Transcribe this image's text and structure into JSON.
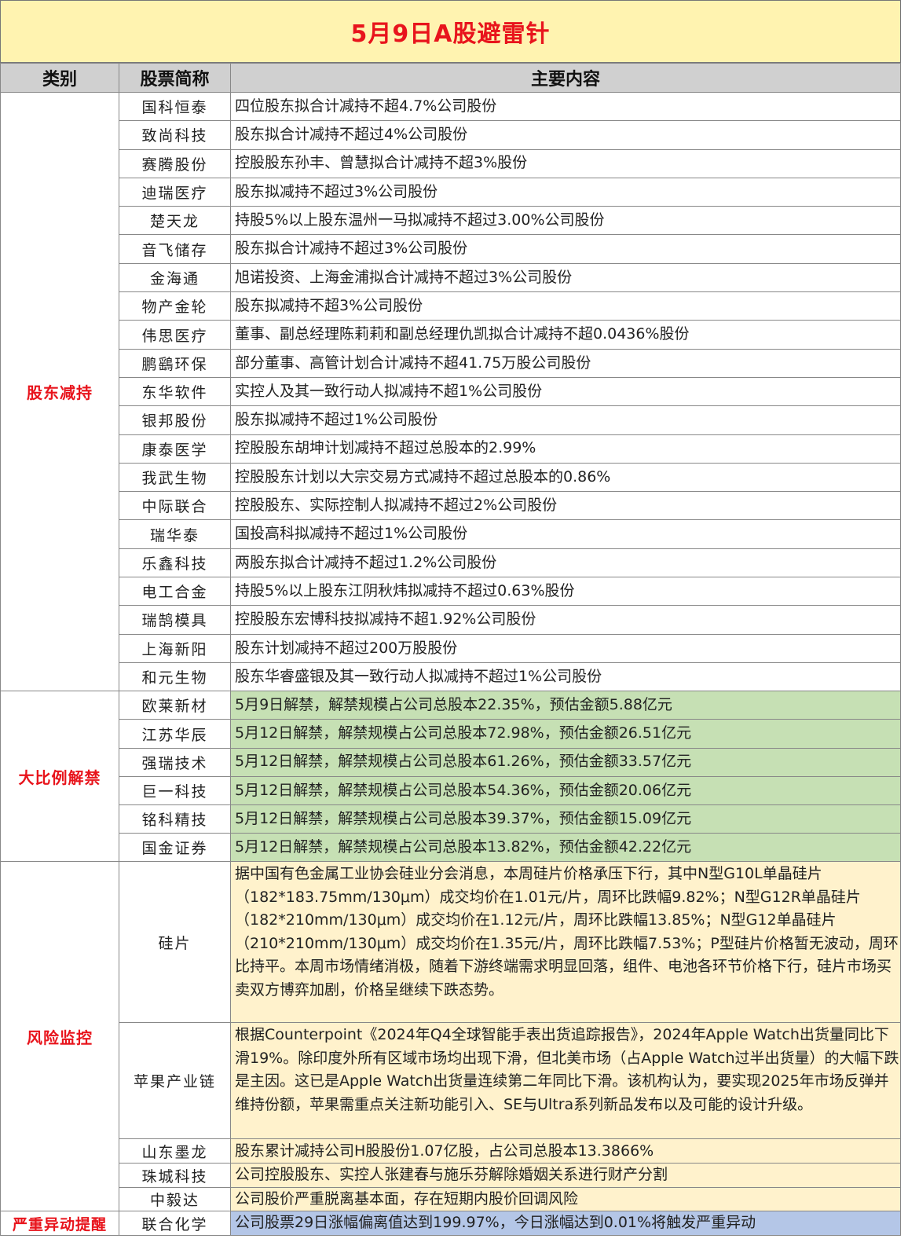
{
  "title": "5月9日A股避雷针",
  "headers": {
    "category": "类别",
    "stock": "股票简称",
    "content": "主要内容"
  },
  "sections": [
    {
      "category": "股东减持",
      "style": "plain",
      "rows": [
        {
          "name": "国科恒泰",
          "content": "四位股东拟合计减持不超4.7%公司股份"
        },
        {
          "name": "致尚科技",
          "content": "股东拟合计减持不超过4%公司股份"
        },
        {
          "name": "赛腾股份",
          "content": "控股股东孙丰、曾慧拟合计减持不超3%股份"
        },
        {
          "name": "迪瑞医疗",
          "content": "股东拟减持不超过3%公司股份"
        },
        {
          "name": "楚天龙",
          "content": "持股5%以上股东温州一马拟减持不超过3.00%公司股份"
        },
        {
          "name": "音飞储存",
          "content": "股东拟合计减持不超过3%公司股份"
        },
        {
          "name": "金海通",
          "content": "旭诺投资、上海金浦拟合计减持不超过3%公司股份"
        },
        {
          "name": "物产金轮",
          "content": "股东拟减持不超3%公司股份"
        },
        {
          "name": "伟思医疗",
          "content": "董事、副总经理陈莉莉和副总经理仇凯拟合计减持不超0.0436%股份"
        },
        {
          "name": "鹏鷂环保",
          "content": "部分董事、高管计划合计减持不超41.75万股公司股份"
        },
        {
          "name": "东华软件",
          "content": "实控人及其一致行动人拟减持不超1%公司股份"
        },
        {
          "name": "银邦股份",
          "content": "股东拟减持不超过1%公司股份"
        },
        {
          "name": "康泰医学",
          "content": "控股股东胡坤计划减持不超过总股本的2.99%"
        },
        {
          "name": "我武生物",
          "content": "控股股东计划以大宗交易方式减持不超过总股本的0.86%"
        },
        {
          "name": "中际联合",
          "content": "控股股东、实际控制人拟减持不超过2%公司股份"
        },
        {
          "name": "瑞华泰",
          "content": "国投高科拟减持不超过1%公司股份"
        },
        {
          "name": "乐鑫科技",
          "content": "两股东拟合计减持不超过1.2%公司股份"
        },
        {
          "name": "电工合金",
          "content": "持股5%以上股东江阴秋炜拟减持不超过0.63%股份"
        },
        {
          "name": "瑞鹄模具",
          "content": "控股股东宏博科技拟减持不超1.92%公司股份"
        },
        {
          "name": "上海新阳",
          "content": "股东计划减持不超过200万股股份"
        },
        {
          "name": "和元生物",
          "content": "股东华睿盛银及其一致行动人拟减持不超过1%公司股份"
        }
      ]
    },
    {
      "category": "大比例解禁",
      "style": "green",
      "rows": [
        {
          "name": "欧莱新材",
          "content": "5月9日解禁，解禁规模占公司总股本22.35%，预估金额5.88亿元"
        },
        {
          "name": "江苏华辰",
          "content": "5月12日解禁，解禁规模占公司总股本72.98%，预估金额26.51亿元"
        },
        {
          "name": "强瑞技术",
          "content": "5月12日解禁，解禁规模占公司总股本61.26%，预估金额33.57亿元"
        },
        {
          "name": "巨一科技",
          "content": "5月12日解禁，解禁规模占公司总股本54.36%，预估金额20.06亿元"
        },
        {
          "name": "铭科精技",
          "content": "5月12日解禁，解禁规模占公司总股本39.37%，预估金额15.09亿元"
        },
        {
          "name": "国金证券",
          "content": "5月12日解禁，解禁规模占公司总股本13.82%，预估金额42.22亿元"
        }
      ]
    },
    {
      "category": "风险监控",
      "style": "yellow",
      "rows": [
        {
          "name": "硅片",
          "content": "据中国有色金属工业协会硅业分会消息，本周硅片价格承压下行，其中N型G10L单晶硅片（182*183.75mm/130μm）成交均价在1.01元/片，周环比跌幅9.82%；N型G12R单晶硅片（182*210mm/130μm）成交均价在1.12元/片，周环比跌幅13.85%；N型G12单晶硅片（210*210mm/130μm）成交均价在1.35元/片，周环比跌幅7.53%；P型硅片价格暂无波动，周环比持平。本周市场情绪消极，随着下游终端需求明显回落，组件、电池各环节价格下行，硅片市场买卖双方博弈加剧，价格呈继续下跌态势。"
        },
        {
          "name": "苹果产业链",
          "content": "根据Counterpoint《2024年Q4全球智能手表出货追踪报告》，2024年Apple Watch出货量同比下滑19%。除印度外所有区域市场均出现下滑，但北美市场（占Apple Watch过半出货量）的大幅下跌是主因。这已是Apple Watch出货量连续第二年同比下滑。该机构认为，要实现2025年市场反弹并维持份额，苹果需重点关注新功能引入、SE与Ultra系列新品发布以及可能的设计升级。"
        },
        {
          "name": "山东墨龙",
          "content": "股东累计减持公司H股股份1.07亿股，占公司总股本13.3866%"
        },
        {
          "name": "珠城科技",
          "content": "公司控股股东、实控人张建春与施乐芬解除婚姻关系进行财产分割"
        },
        {
          "name": "中毅达",
          "content": "公司股价严重脱离基本面，存在短期内股价回调风险"
        }
      ]
    },
    {
      "category": "严重异动提醒",
      "style": "blue",
      "rows": [
        {
          "name": "联合化学",
          "content": "公司股票29日涨幅偏离值达到199.97%，今日涨幅达到0.01%将触发严重异动"
        }
      ]
    }
  ],
  "colors": {
    "title_bg": "#fff3b0",
    "title_text": "#e8141c",
    "header_bg": "#d0d0d0",
    "green_row": "#c6e0b4",
    "yellow_row": "#fff2cc",
    "blue_row": "#b4c6e7",
    "category_text": "#e8141c"
  }
}
